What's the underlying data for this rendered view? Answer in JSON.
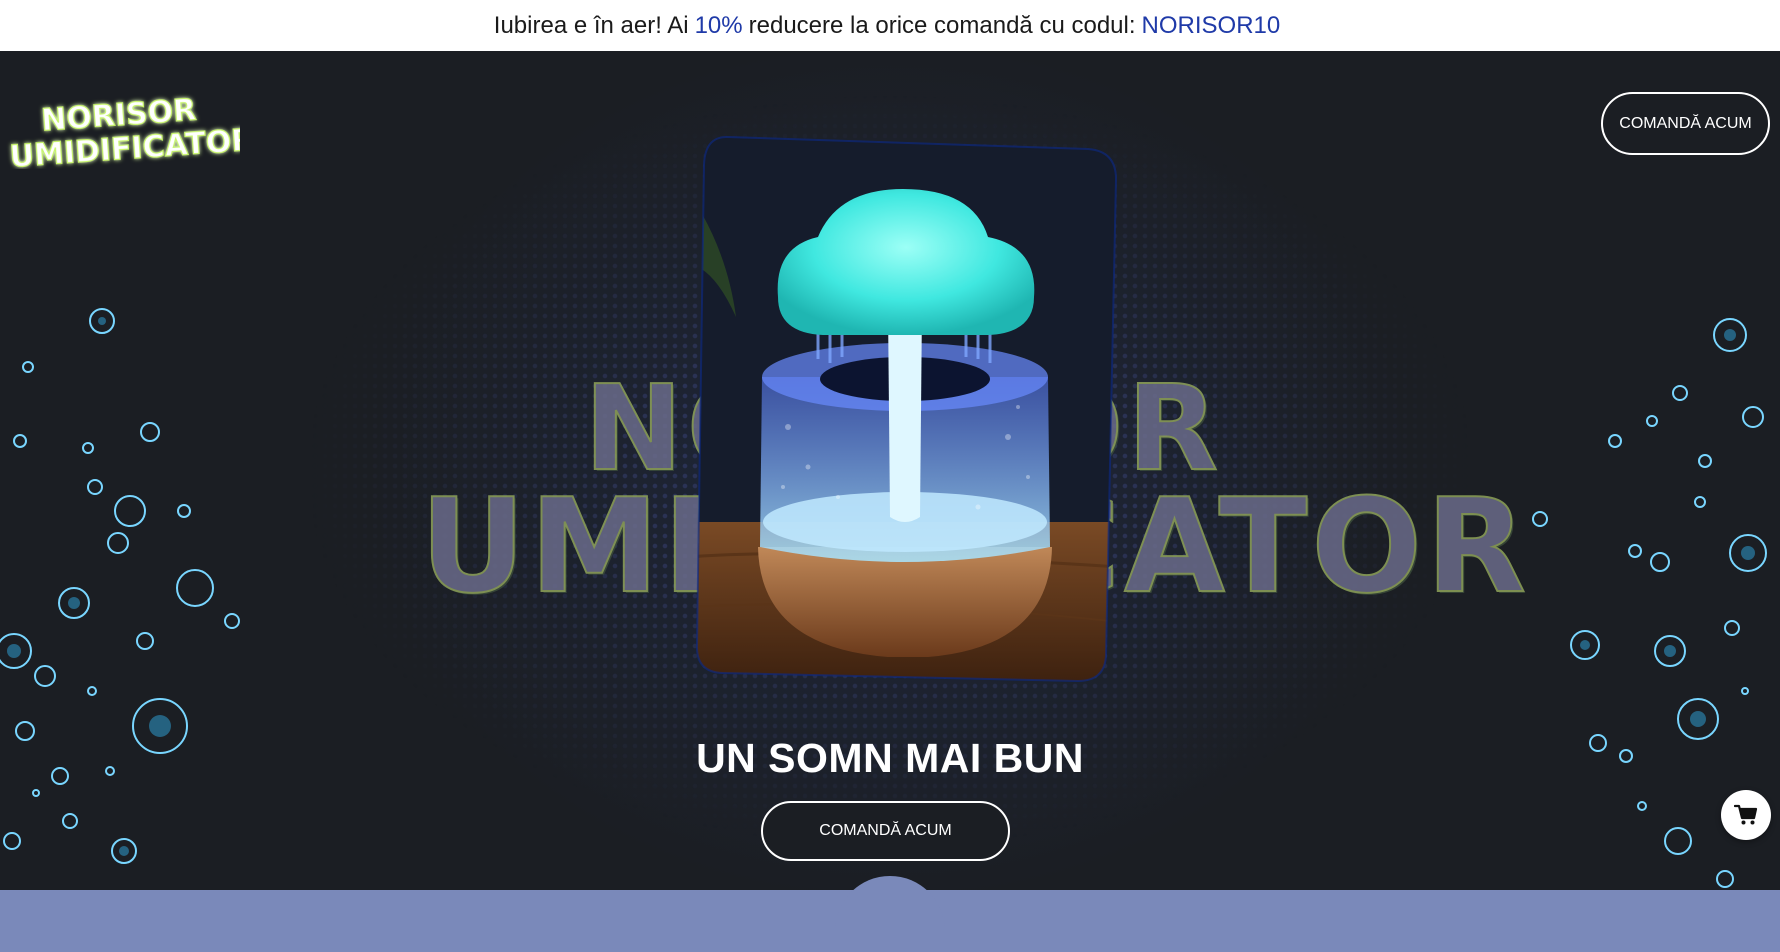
{
  "announcement": {
    "text_before": "Iubirea e în aer! Ai",
    "discount": "10%",
    "text_middle": "reducere la orice comandă cu codul:",
    "code": "NORISOR10"
  },
  "header": {
    "logo_line1": "NORISOR",
    "logo_line2": "UMIDIFICATOR",
    "cta_label": "COMANDĂ ACUM"
  },
  "hero": {
    "background_word_line1": "NORISOR",
    "background_word_line2": "UMIDIFICATOR",
    "product_image": "rain-cloud-humidifier-photo",
    "headline": "UN SOMN MAI BUN",
    "cta_label": "COMANDĂ ACUM"
  },
  "floating": {
    "cart_icon": "cart-icon"
  },
  "colors": {
    "accent_blue": "#1f3aa8",
    "hero_bg": "#1b1e23",
    "logo_green": "#c8f56a",
    "bottom_band": "#7a89ba",
    "glow_cyan": "#40e8e0"
  }
}
